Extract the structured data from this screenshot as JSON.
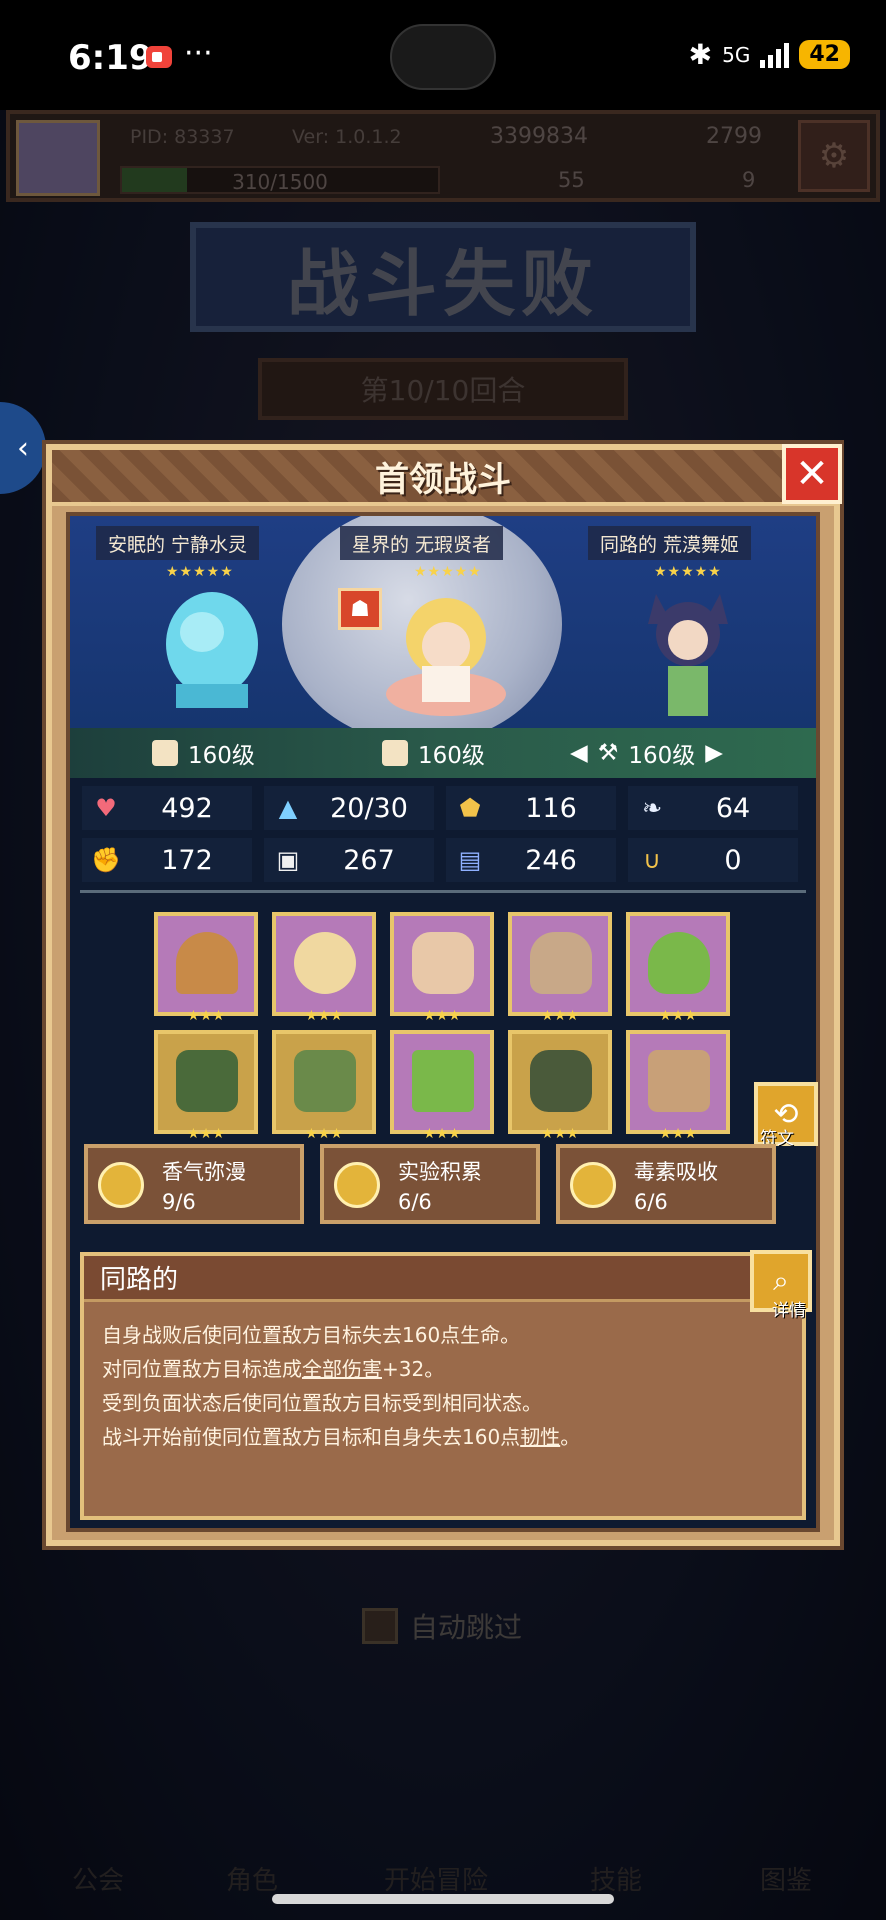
{
  "status_bar": {
    "time": "6:19",
    "dots": "···",
    "bluetooth": "✱",
    "network": "5G",
    "battery": "42"
  },
  "player": {
    "pid": "PID: 83337",
    "version": "Ver: 1.0.1.2",
    "gold": "3399834",
    "gems": "2799",
    "xp": "310/1500",
    "xp_fraction": 0.2067,
    "clover": "55",
    "shards": "9"
  },
  "battle": {
    "result_title": "战斗失败",
    "round": "第10/10回合"
  },
  "modal": {
    "title": "首领战斗",
    "close": "✕",
    "heroes": [
      {
        "name": "安眠的 宁静水灵",
        "stars": "★★★★★",
        "level": "160级"
      },
      {
        "name": "星界的 无瑕贤者",
        "stars": "★★★★★",
        "level": "160级"
      },
      {
        "name": "同路的 荒漠舞姬",
        "stars": "★★★★★",
        "level": "160级"
      }
    ],
    "stats": [
      {
        "icon": "heart-icon",
        "glyph": "♥",
        "color": "#f26a7a",
        "value": "492"
      },
      {
        "icon": "mana-drop-icon",
        "glyph": "▲",
        "color": "#7fd0ff",
        "value": "20/30"
      },
      {
        "icon": "shield-icon",
        "glyph": "⬟",
        "color": "#f2c24a",
        "value": "116"
      },
      {
        "icon": "wing-icon",
        "glyph": "❧",
        "color": "#e8f0ff",
        "value": "64"
      },
      {
        "icon": "fist-icon",
        "glyph": "✊",
        "color": "#f3a0a0",
        "value": "172"
      },
      {
        "icon": "book-icon",
        "glyph": "▣",
        "color": "#f0f0f0",
        "value": "267"
      },
      {
        "icon": "scroll-icon",
        "glyph": "▤",
        "color": "#8fb0ff",
        "value": "246"
      },
      {
        "icon": "magnet-icon",
        "glyph": "∪",
        "color": "#f2c24a",
        "value": "0"
      }
    ],
    "equipment_stars": "★★★",
    "rune_label": "符文",
    "sets": [
      {
        "name": "香气弥漫",
        "count": "9/6"
      },
      {
        "name": "实验积累",
        "count": "6/6"
      },
      {
        "name": "毒素吸收",
        "count": "6/6"
      }
    ],
    "description": {
      "title": "同路的",
      "detail_label": "详情",
      "line1": "自身战败后使同位置敌方目标失去160点生命。",
      "line2_a": "对同位置敌方目标造成",
      "line2_u": "全部伤害",
      "line2_b": "+32。",
      "line3": "受到负面状态后使同位置敌方目标受到相同状态。",
      "line4_a": "战斗开始前使同位置敌方目标和自身失去160点",
      "line4_u": "韧性",
      "line4_b": "。"
    }
  },
  "auto_skip_label": "自动跳过",
  "nav": [
    "公会",
    "角色",
    "开始冒险",
    "技能",
    "图鉴"
  ]
}
